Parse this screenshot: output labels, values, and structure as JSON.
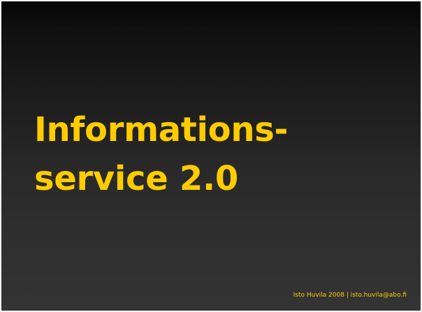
{
  "slide": {
    "title_line1": "Informations-",
    "title_line2": "service 2.0",
    "footer": "Isto Huvila 2008 | isto.huvila@abo.fi"
  },
  "colors": {
    "accent": "#ffcc00",
    "background_top": "#050505",
    "background_bottom": "#343434"
  }
}
